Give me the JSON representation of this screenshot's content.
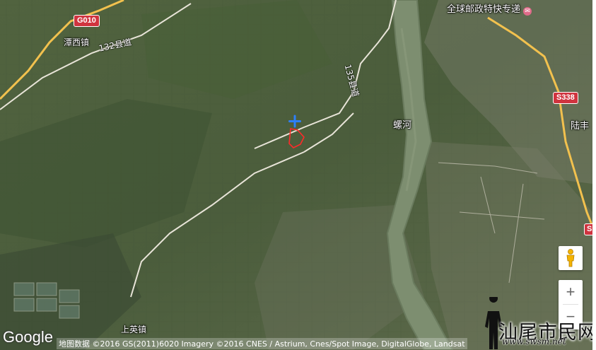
{
  "map": {
    "place_labels": {
      "tanxi": "潭西镇",
      "shangying": "上英镇",
      "luofeng": "陆丰",
      "river": "螺河"
    },
    "road_labels": {
      "county_132": "132县道",
      "county_135": "135县道"
    },
    "shields": {
      "g010": "G010",
      "s338": "S338",
      "s_partial": "S"
    },
    "poi": {
      "post_office": "全球邮政特快专递"
    },
    "marker_icon": "crosshair-marker-icon",
    "boundary_color": "#ff2a2a"
  },
  "controls": {
    "pegman_icon": "pegman-icon",
    "zoom_in": "+",
    "zoom_out": "−"
  },
  "footer": {
    "logo": "Google",
    "attribution": "地图数据 ©2016 GS(2011)6020 Imagery ©2016 CNES / Astrium, Cnes/Spot Image, DigitalGlobe, Landsat"
  },
  "watermark": {
    "title": "汕尾市民网",
    "url": "www.swsm.net"
  },
  "colors": {
    "highway_shield": "#d0343f",
    "road": "#e8e4d8",
    "highway": "#f2c14e",
    "river": "#7d8e70"
  }
}
